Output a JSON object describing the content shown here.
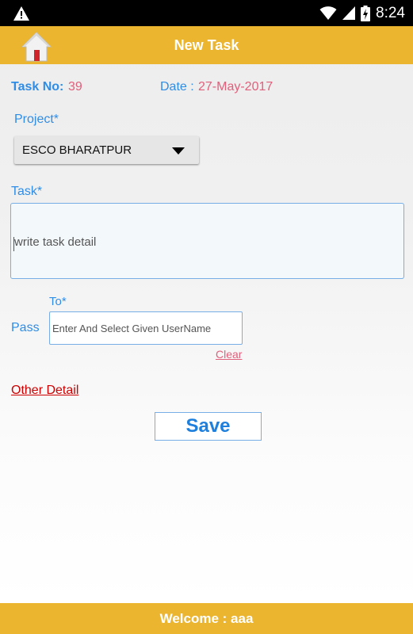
{
  "status_bar": {
    "time": "8:24",
    "icons": [
      "warning-icon",
      "wifi-icon",
      "signal-icon",
      "battery-charging-icon"
    ]
  },
  "app_bar": {
    "title": "New Task",
    "home_icon": "home-icon"
  },
  "task_info": {
    "task_no_label": "Task No:",
    "task_no_value": "39",
    "date_label": "Date :",
    "date_value": "27-May-2017"
  },
  "project": {
    "label": "Project*",
    "selected": "ESCO BHARATPUR"
  },
  "task": {
    "label": "Task*",
    "placeholder": "write task detail",
    "value": ""
  },
  "assign": {
    "to_label": "To*",
    "pass_label": "Pass",
    "user_placeholder": "Enter And Select Given UserName",
    "clear_label": "Clear"
  },
  "other_detail": {
    "label": "Other Detail"
  },
  "save": {
    "label": "Save"
  },
  "footer": {
    "welcome_label": "Welcome",
    "separator": ":",
    "username": "aaa"
  },
  "colors": {
    "accent": "#ecb52f",
    "label_blue": "#2f8de6",
    "value_pink": "#e0607c",
    "link_red": "#cc0000"
  }
}
